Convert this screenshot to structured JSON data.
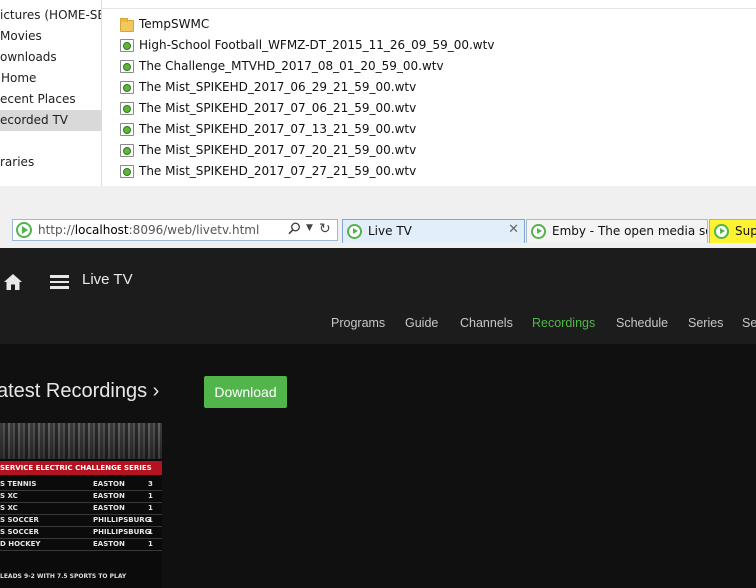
{
  "explorer": {
    "nav_items": [
      {
        "label": "ictures (HOME-SER",
        "selected": false
      },
      {
        "label": "Movies",
        "selected": false
      },
      {
        "label": "ownloads",
        "selected": false
      },
      {
        "label": "Home",
        "selected": false
      },
      {
        "label": "ecent Places",
        "selected": false
      },
      {
        "label": "ecorded TV",
        "selected": true
      },
      {
        "label": "",
        "selected": false
      },
      {
        "label": "raries",
        "selected": false
      }
    ],
    "files": [
      {
        "name": "TempSWMC",
        "icon": "folder-icon"
      },
      {
        "name": "High-School Football_WFMZ-DT_2015_11_26_09_59_00.wtv",
        "icon": "wtv-file-icon"
      },
      {
        "name": "The Challenge_MTVHD_2017_08_01_20_59_00.wtv",
        "icon": "wtv-file-icon"
      },
      {
        "name": "The Mist_SPIKEHD_2017_06_29_21_59_00.wtv",
        "icon": "wtv-file-icon"
      },
      {
        "name": "The Mist_SPIKEHD_2017_07_06_21_59_00.wtv",
        "icon": "wtv-file-icon"
      },
      {
        "name": "The Mist_SPIKEHD_2017_07_13_21_59_00.wtv",
        "icon": "wtv-file-icon"
      },
      {
        "name": "The Mist_SPIKEHD_2017_07_20_21_59_00.wtv",
        "icon": "wtv-file-icon"
      },
      {
        "name": "The Mist_SPIKEHD_2017_07_27_21_59_00.wtv",
        "icon": "wtv-file-icon"
      }
    ]
  },
  "browser": {
    "address_prefix": "http://",
    "address_host": "localhost",
    "address_rest": ":8096/web/livetv.html",
    "tabs": [
      {
        "label": "Live TV",
        "active": true
      },
      {
        "label": "Emby - The open media so...",
        "active": false
      },
      {
        "label": "Supp",
        "active": false
      }
    ],
    "close_glyph": "✕"
  },
  "app": {
    "title": "Live TV",
    "nav_tabs": [
      {
        "label": "Programs",
        "active": false
      },
      {
        "label": "Guide",
        "active": false
      },
      {
        "label": "Channels",
        "active": false
      },
      {
        "label": "Recordings",
        "active": true
      },
      {
        "label": "Schedule",
        "active": false
      },
      {
        "label": "Series",
        "active": false
      },
      {
        "label": "Se",
        "active": false
      }
    ],
    "section_title": "atest Recordings",
    "section_chevron": "›",
    "download_label": "Download",
    "accent_color": "#52b54b",
    "thumbnail": {
      "banner": "SERVICE ELECTRIC CHALLENGE SERIES",
      "rows": [
        {
          "c1": "S TENNIS",
          "c2": "EASTON",
          "c3": "3"
        },
        {
          "c1": "S XC",
          "c2": "EASTON",
          "c3": "1"
        },
        {
          "c1": "S XC",
          "c2": "EASTON",
          "c3": "1"
        },
        {
          "c1": "S SOCCER",
          "c2": "PHILLIPSBURG",
          "c3": "1"
        },
        {
          "c1": "S SOCCER",
          "c2": "PHILLIPSBURG",
          "c3": "1"
        },
        {
          "c1": "D HOCKEY",
          "c2": "EASTON",
          "c3": "1"
        }
      ],
      "footer": "LEADS 9-2 WITH 7.5 SPORTS TO PLAY"
    }
  }
}
